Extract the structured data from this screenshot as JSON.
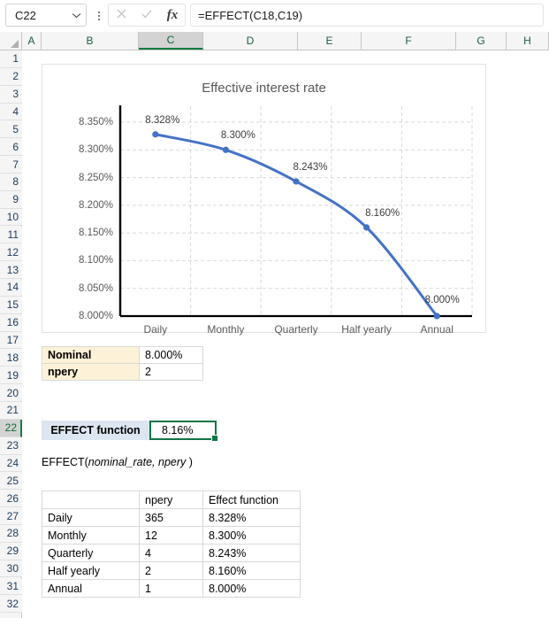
{
  "formula_bar": {
    "name_box_value": "C22",
    "formula": "=EFFECT(C18,C19)",
    "cancel_icon": "close-icon",
    "enter_icon": "check-icon",
    "fx_icon": "fx",
    "chevron_icon": "chevron-down-icon"
  },
  "grid": {
    "columns": [
      "A",
      "B",
      "C",
      "D",
      "E",
      "F",
      "G",
      "H"
    ],
    "selected_column": "C",
    "rows": [
      1,
      2,
      3,
      4,
      5,
      6,
      7,
      8,
      9,
      10,
      11,
      12,
      13,
      14,
      15,
      16,
      17,
      18,
      19,
      20,
      21,
      22,
      23,
      24,
      25,
      26,
      27,
      28,
      29,
      30,
      31,
      32
    ],
    "selected_row": 22
  },
  "chart_data": {
    "type": "line",
    "title": "Effective interest rate",
    "categories": [
      "Daily",
      "Monthly",
      "Quarterly",
      "Half yearly",
      "Annual"
    ],
    "values": [
      8.328,
      8.3,
      8.243,
      8.16,
      8.0
    ],
    "data_labels": [
      "8.328%",
      "8.300%",
      "8.243%",
      "8.160%",
      "8.000%"
    ],
    "ylim": [
      8.0,
      8.35
    ],
    "ytick_values": [
      8.0,
      8.05,
      8.1,
      8.15,
      8.2,
      8.25,
      8.3,
      8.35
    ],
    "ytick_labels": [
      "8.000%",
      "8.050%",
      "8.100%",
      "8.150%",
      "8.200%",
      "8.250%",
      "8.300%",
      "8.350%"
    ],
    "xlabel": "",
    "ylabel": "",
    "grid": true,
    "legend": "none",
    "series_color": "#4472c4",
    "marker_color": "#4472c4"
  },
  "nominal_table": {
    "rows": [
      {
        "label": "Nominal",
        "value": "8.000%"
      },
      {
        "label": "npery",
        "value": "2"
      }
    ]
  },
  "effect_result": {
    "label": "EFFECT function",
    "value": "8.16%"
  },
  "syntax": {
    "prefix": "EFFECT(",
    "args": "nominal_rate, npery",
    "suffix": " )"
  },
  "data_table": {
    "headers": [
      "",
      "npery",
      "Effect function"
    ],
    "rows": [
      {
        "name": "Daily",
        "npery": "365",
        "effect": "8.328%"
      },
      {
        "name": "Monthly",
        "npery": "12",
        "effect": "8.300%"
      },
      {
        "name": "Quarterly",
        "npery": "4",
        "effect": "8.243%"
      },
      {
        "name": "Half yearly",
        "npery": "2",
        "effect": "8.160%"
      },
      {
        "name": "Annual",
        "npery": "1",
        "effect": "8.000%"
      }
    ]
  },
  "colors": {
    "accent": "#4472c4",
    "selection_green": "#137547",
    "header_grey": "#f5f5f5",
    "cream": "#fdf2d7",
    "light_blue": "#dce6f1"
  }
}
